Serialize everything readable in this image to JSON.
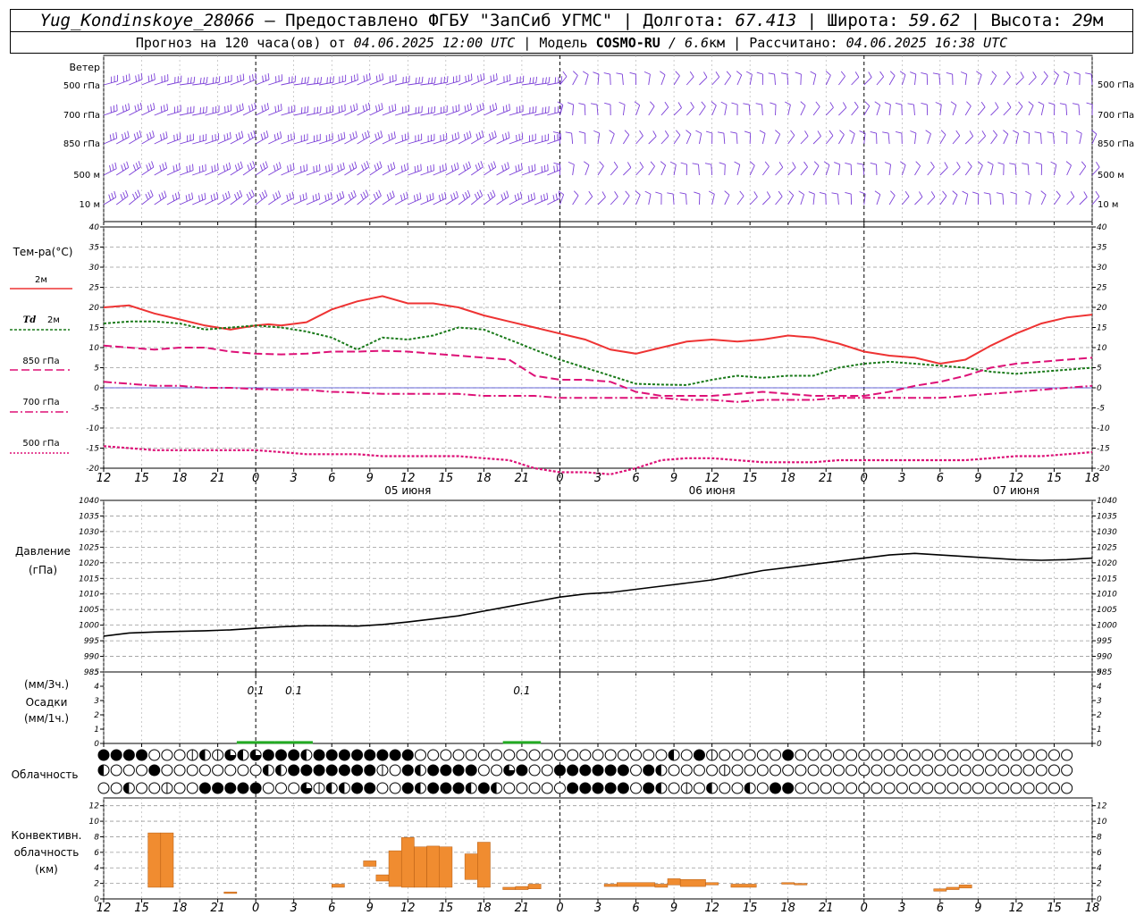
{
  "header": {
    "station": "Yug_Kondinskoye_28066",
    "dash": " – ",
    "provider": "Предоставлено ФГБУ \"ЗапСиб УГМС\"",
    "sep": " | ",
    "lon_label": "Долгота: ",
    "lon_value": "67.413",
    "lat_label": "Широта: ",
    "lat_value": "59.62",
    "alt_label": "Высота: ",
    "alt_value": "29",
    "alt_unit": "м",
    "forecast_label": "Прогноз на 120 часа(ов) от ",
    "forecast_time": "04.06.2025 12:00 UTC",
    "model_label": "Модель ",
    "model_name": "COSMO-RU",
    "model_res": "6.6",
    "model_res_unit": "км",
    "calc_label": "Рассчитано: ",
    "calc_time": "04.06.2025 16:38 UTC"
  },
  "wind": {
    "title": "Ветер",
    "levels": [
      "500 гПа",
      "700 гПа",
      "850 гПа",
      "500 м",
      "10 м"
    ],
    "levels_right": [
      "500 гПа",
      "700 гПа",
      "850 гПа",
      "500 м",
      "10 м"
    ]
  },
  "temperature": {
    "title": "Тем-ра(°С)",
    "legend": [
      {
        "label": "2м",
        "color": "#ee3333",
        "style": "solid"
      },
      {
        "label_prefix": "Td",
        "label": "2м",
        "color": "#1a7a1a",
        "style": "dotted"
      },
      {
        "label": "850 гПа",
        "color": "#dd1177",
        "style": "dashed"
      },
      {
        "label": "700 гПа",
        "color": "#dd1177",
        "style": "dashdot"
      },
      {
        "label": "500 гПа",
        "color": "#dd1177",
        "style": "dotted"
      }
    ]
  },
  "pressure": {
    "title": "Давление",
    "unit": "(гПа)"
  },
  "precip": {
    "unit_3h": "(мм/3ч.)",
    "title": "Осадки",
    "unit_1h": "(мм/1ч.)",
    "labels": [
      {
        "hour": 12,
        "text": "0.1"
      },
      {
        "hour": 15,
        "text": "0.1"
      },
      {
        "hour": 33,
        "text": "0.1"
      }
    ]
  },
  "clouds": {
    "title": "Облачность"
  },
  "convective": {
    "title_1": "Конвективн.",
    "title_2": "облачность",
    "unit": "(км)"
  },
  "x_ticks": [
    "12",
    "15",
    "18",
    "21",
    "0",
    "3",
    "6",
    "9",
    "12",
    "15",
    "18",
    "21",
    "0",
    "3",
    "6",
    "9",
    "12",
    "15",
    "18",
    "21",
    "0",
    "3",
    "6",
    "9",
    "12",
    "15",
    "18"
  ],
  "date_labels": [
    {
      "hour": 24,
      "text": "05 июня"
    },
    {
      "hour": 48,
      "text": "06 июня"
    },
    {
      "hour": 72,
      "text": "07 июня"
    }
  ],
  "chart_data": [
    {
      "type": "line",
      "title": "Тем-ра(°С)",
      "x_unit": "hours since 04.06.2025 12:00 UTC",
      "ylim": [
        -20,
        40
      ],
      "y_ticks": [
        40,
        35,
        30,
        25,
        20,
        15,
        10,
        5,
        0,
        -5,
        -10,
        -15,
        -20
      ],
      "grid": true,
      "series": [
        {
          "name": "2м",
          "color": "#ee3333",
          "style": "solid",
          "x": [
            0,
            2,
            4,
            6,
            8,
            10,
            11,
            12,
            13,
            14,
            16,
            18,
            20,
            22,
            24,
            26,
            28,
            30,
            32,
            34,
            36,
            38,
            40,
            42,
            44,
            46,
            48,
            50,
            52,
            54,
            56,
            58,
            60,
            62,
            64,
            66,
            68,
            70,
            72,
            74,
            76,
            78
          ],
          "y": [
            20,
            20.5,
            18.5,
            17,
            15.5,
            14.5,
            15,
            15.5,
            15.8,
            15.5,
            16.3,
            19.5,
            21.5,
            22.8,
            21,
            21,
            20,
            18,
            16.5,
            15,
            13.5,
            12,
            9.5,
            8.5,
            10,
            11.5,
            12,
            11.5,
            12,
            13,
            12.5,
            11,
            9,
            8,
            7.5,
            6,
            7,
            10.5,
            13.5,
            16,
            17.5,
            18.2
          ]
        },
        {
          "name": "Td 2м",
          "color": "#1a7a1a",
          "style": "dotted",
          "x": [
            0,
            2,
            4,
            6,
            8,
            10,
            12,
            14,
            16,
            18,
            20,
            22,
            24,
            26,
            28,
            30,
            32,
            34,
            36,
            38,
            40,
            42,
            44,
            46,
            48,
            50,
            52,
            54,
            56,
            58,
            60,
            62,
            64,
            66,
            68,
            70,
            72,
            74,
            76,
            78
          ],
          "y": [
            16,
            16.5,
            16.5,
            16,
            14.5,
            15,
            15.5,
            15,
            14,
            12.5,
            9.5,
            12.5,
            12,
            13,
            15,
            14.5,
            12,
            9.5,
            7,
            5,
            3,
            1,
            0.8,
            0.7,
            2,
            3,
            2.5,
            3,
            3,
            5,
            6,
            6.5,
            6,
            5.5,
            5,
            4,
            3.5,
            4,
            4.5,
            5
          ]
        },
        {
          "name": "850 гПа",
          "color": "#dd1177",
          "style": "dashed",
          "x": [
            0,
            2,
            4,
            6,
            8,
            10,
            12,
            14,
            16,
            18,
            20,
            22,
            24,
            26,
            28,
            30,
            32,
            34,
            36,
            38,
            40,
            42,
            44,
            46,
            48,
            50,
            52,
            54,
            56,
            58,
            60,
            62,
            64,
            66,
            68,
            70,
            72,
            74,
            76,
            78
          ],
          "y": [
            10.5,
            10,
            9.5,
            10,
            10,
            9,
            8.5,
            8.3,
            8.5,
            9,
            9,
            9.2,
            9,
            8.5,
            8,
            7.5,
            7,
            3,
            2,
            2,
            1.5,
            -1,
            -2,
            -2,
            -2,
            -1.5,
            -1,
            -1.5,
            -2,
            -2,
            -2,
            -1,
            0.5,
            1.5,
            3,
            5,
            6,
            6.5,
            7,
            7.5
          ]
        },
        {
          "name": "700 гПа",
          "color": "#dd1177",
          "style": "dashdot",
          "x": [
            0,
            2,
            4,
            6,
            8,
            10,
            12,
            14,
            16,
            18,
            20,
            22,
            24,
            26,
            28,
            30,
            32,
            34,
            36,
            38,
            40,
            42,
            44,
            46,
            48,
            50,
            52,
            54,
            56,
            58,
            60,
            62,
            64,
            66,
            68,
            70,
            72,
            74,
            76,
            78
          ],
          "y": [
            1.5,
            1,
            0.5,
            0.5,
            0,
            0,
            -0.3,
            -0.5,
            -0.5,
            -1,
            -1.2,
            -1.5,
            -1.5,
            -1.5,
            -1.5,
            -2,
            -2,
            -2,
            -2.5,
            -2.5,
            -2.5,
            -2.5,
            -2.5,
            -3,
            -3,
            -3.5,
            -3,
            -3,
            -3,
            -2.5,
            -2.5,
            -2.5,
            -2.5,
            -2.5,
            -2,
            -1.5,
            -1,
            -0.5,
            0,
            0.5
          ]
        },
        {
          "name": "500 гПа",
          "color": "#dd1177",
          "style": "dotted",
          "x": [
            0,
            2,
            4,
            6,
            8,
            10,
            12,
            14,
            16,
            18,
            20,
            22,
            24,
            26,
            28,
            30,
            32,
            34,
            36,
            38,
            40,
            42,
            44,
            46,
            48,
            50,
            52,
            54,
            56,
            58,
            60,
            62,
            64,
            66,
            68,
            70,
            72,
            74,
            76,
            78
          ],
          "y": [
            -14.5,
            -15,
            -15.5,
            -15.5,
            -15.5,
            -15.5,
            -15.5,
            -16,
            -16.5,
            -16.5,
            -16.5,
            -17,
            -17,
            -17,
            -17,
            -17.5,
            -18,
            -20,
            -21,
            -21,
            -21.5,
            -20,
            -18,
            -17.5,
            -17.5,
            -18,
            -18.5,
            -18.5,
            -18.5,
            -18,
            -18,
            -18,
            -18,
            -18,
            -18,
            -17.5,
            -17,
            -17,
            -16.5,
            -16
          ]
        }
      ]
    },
    {
      "type": "line",
      "title": "Давление",
      "ylabel": "(гПа)",
      "x_unit": "hours since 04.06.2025 12:00 UTC",
      "ylim": [
        985,
        1040
      ],
      "y_ticks": [
        1040,
        1035,
        1030,
        1025,
        1020,
        1015,
        1010,
        1005,
        1000,
        995,
        990,
        985
      ],
      "grid": true,
      "series": [
        {
          "name": "Давление",
          "color": "#000000",
          "x": [
            0,
            2,
            4,
            6,
            8,
            10,
            12,
            14,
            16,
            18,
            20,
            22,
            24,
            26,
            28,
            30,
            32,
            34,
            36,
            38,
            40,
            42,
            44,
            46,
            48,
            50,
            52,
            54,
            56,
            58,
            60,
            62,
            64,
            66,
            68,
            70,
            72,
            74,
            76,
            78
          ],
          "y": [
            996.5,
            997.5,
            997.8,
            998,
            998.2,
            998.5,
            999,
            999.5,
            999.8,
            999.8,
            999.7,
            1000.2,
            1001,
            1002,
            1003,
            1004.5,
            1006,
            1007.5,
            1009,
            1010,
            1010.5,
            1011.5,
            1012.5,
            1013.5,
            1014.5,
            1016,
            1017.5,
            1018.5,
            1019.5,
            1020.5,
            1021.5,
            1022.5,
            1023,
            1022.5,
            1022,
            1021.5,
            1021,
            1020.8,
            1021,
            1021.5
          ]
        }
      ]
    },
    {
      "type": "bar",
      "title": "Осадки",
      "ylabel": "(мм/3ч.)",
      "ylim": [
        0,
        5
      ],
      "y_ticks": [
        5,
        4,
        3,
        2,
        1,
        0
      ],
      "series": [
        {
          "name": "Осадки",
          "color": "#22aa22",
          "x": [
            12,
            15,
            33
          ],
          "y": [
            0.1,
            0.1,
            0.1
          ]
        }
      ]
    },
    {
      "type": "bar",
      "title": "Конвективн. облачность",
      "ylabel": "(км)",
      "ylim": [
        0,
        13
      ],
      "y_ticks": [
        12,
        10,
        8,
        6,
        4,
        2,
        0
      ],
      "bar_color": "#f08c30",
      "bars": [
        {
          "x0": 3.5,
          "x1": 4.5,
          "bottom": 1.5,
          "top": 8.5
        },
        {
          "x0": 4.5,
          "x1": 5.5,
          "bottom": 1.5,
          "top": 8.5
        },
        {
          "x0": 9.5,
          "x1": 10.5,
          "bottom": 0.7,
          "top": 0.9
        },
        {
          "x0": 18,
          "x1": 19,
          "bottom": 1.5,
          "top": 1.9
        },
        {
          "x0": 20.5,
          "x1": 21.5,
          "bottom": 4.2,
          "top": 4.9
        },
        {
          "x0": 21.5,
          "x1": 22.5,
          "bottom": 2.3,
          "top": 3.1
        },
        {
          "x0": 22.5,
          "x1": 23.5,
          "bottom": 1.6,
          "top": 6.2
        },
        {
          "x0": 23.5,
          "x1": 24.5,
          "bottom": 1.5,
          "top": 7.9
        },
        {
          "x0": 24.5,
          "x1": 25.5,
          "bottom": 1.5,
          "top": 6.7
        },
        {
          "x0": 25.5,
          "x1": 26.5,
          "bottom": 1.5,
          "top": 6.8
        },
        {
          "x0": 26.5,
          "x1": 27.5,
          "bottom": 1.5,
          "top": 6.7
        },
        {
          "x0": 28.5,
          "x1": 29.5,
          "bottom": 2.5,
          "top": 5.8
        },
        {
          "x0": 29.5,
          "x1": 30.5,
          "bottom": 1.5,
          "top": 7.3
        },
        {
          "x0": 31.5,
          "x1": 32.5,
          "bottom": 1.2,
          "top": 1.5
        },
        {
          "x0": 32.5,
          "x1": 33.5,
          "bottom": 1.2,
          "top": 1.6
        },
        {
          "x0": 33.5,
          "x1": 34.5,
          "bottom": 1.3,
          "top": 1.9
        },
        {
          "x0": 39.5,
          "x1": 40.5,
          "bottom": 1.6,
          "top": 1.9
        },
        {
          "x0": 40.5,
          "x1": 43.5,
          "bottom": 1.6,
          "top": 2.1
        },
        {
          "x0": 43.5,
          "x1": 44.5,
          "bottom": 1.5,
          "top": 1.9
        },
        {
          "x0": 44.5,
          "x1": 45.5,
          "bottom": 1.8,
          "top": 2.6
        },
        {
          "x0": 45.5,
          "x1": 47.5,
          "bottom": 1.6,
          "top": 2.5
        },
        {
          "x0": 47.5,
          "x1": 48.5,
          "bottom": 1.8,
          "top": 2.1
        },
        {
          "x0": 49.5,
          "x1": 51.5,
          "bottom": 1.5,
          "top": 1.9
        },
        {
          "x0": 53.5,
          "x1": 54.5,
          "bottom": 1.9,
          "top": 2.1
        },
        {
          "x0": 54.5,
          "x1": 55.5,
          "bottom": 1.8,
          "top": 2.0
        },
        {
          "x0": 65.5,
          "x1": 66.5,
          "bottom": 1.0,
          "top": 1.3
        },
        {
          "x0": 66.5,
          "x1": 67.5,
          "bottom": 1.2,
          "top": 1.5
        },
        {
          "x0": 67.5,
          "x1": 68.5,
          "bottom": 1.4,
          "top": 1.8
        }
      ]
    }
  ],
  "cloud_rows": [
    "44440001213234442444444440000000000000000000020410000040000000000000000000000",
    "20004000000002244444441042444400340044444404200001000000000000000000000000000",
    "00200100444440003122440042444242000004444404201020020440000000000000000000000"
  ]
}
